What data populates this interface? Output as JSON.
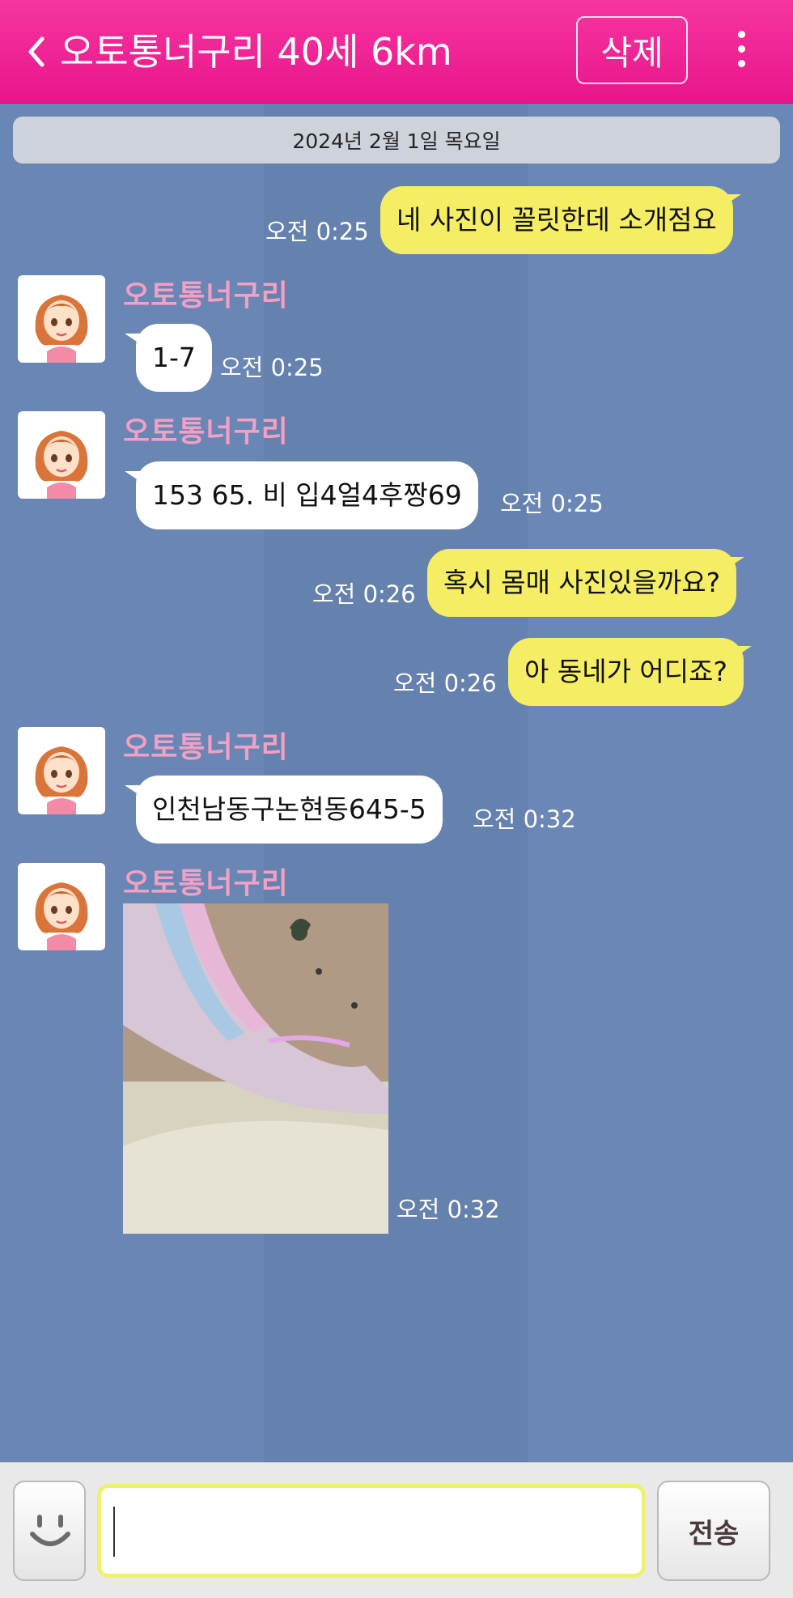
{
  "header": {
    "title": "오토통너구리 40세 6km",
    "delete_label": "삭제",
    "background_color": "#f0228f"
  },
  "date_banner": "2024년 2월 1일 목요일",
  "messages": [
    {
      "from": "me",
      "text": "네 사진이 꼴릿한데 소개점요",
      "time": "오전 0:25"
    },
    {
      "from": "them",
      "sender": "오토통너구리",
      "text": "1-7",
      "time": "오전 0:25"
    },
    {
      "from": "them",
      "sender": "오토통너구리",
      "text": "153 65. 비 입4얼4후짱69",
      "time": "오전 0:25"
    },
    {
      "from": "me",
      "text": "혹시 몸매 사진있을까요?",
      "time": "오전 0:26"
    },
    {
      "from": "me",
      "text": "아 동네가 어디죠?",
      "time": "오전 0:26"
    },
    {
      "from": "them",
      "sender": "오토통너구리",
      "text": "인천남동구논현동645-5",
      "time": "오전 0:32"
    },
    {
      "from": "them",
      "sender": "오토통너구리",
      "type": "photo",
      "time": "오전 0:32"
    }
  ],
  "input": {
    "value": "",
    "send_label": "전송",
    "emoji_icon": "smiley-icon"
  },
  "colors": {
    "my_bubble": "#f5ed63",
    "their_bubble": "#ffffff",
    "sender_name": "#f2a0c4",
    "chat_background": "#6a86b3"
  }
}
